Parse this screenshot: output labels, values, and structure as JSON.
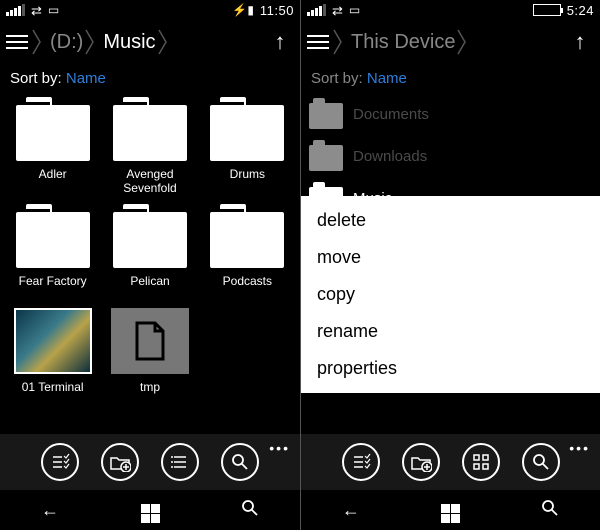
{
  "left": {
    "status": {
      "time": "11:50",
      "battery_charging": true
    },
    "breadcrumb": {
      "drive": "(D:)",
      "folder": "Music"
    },
    "sort": {
      "label": "Sort by: ",
      "value": "Name"
    },
    "items": [
      {
        "label": "Adler",
        "type": "folder"
      },
      {
        "label": "Avenged Sevenfold",
        "type": "folder"
      },
      {
        "label": "Drums",
        "type": "folder"
      },
      {
        "label": "Fear Factory",
        "type": "folder"
      },
      {
        "label": "Pelican",
        "type": "folder"
      },
      {
        "label": "Podcasts",
        "type": "folder"
      },
      {
        "label": "01 Terminal",
        "type": "image"
      },
      {
        "label": "tmp",
        "type": "file"
      }
    ]
  },
  "right": {
    "status": {
      "time": "5:24"
    },
    "breadcrumb": {
      "title": "This Device"
    },
    "sort": {
      "label": "Sort by: ",
      "value": "Name"
    },
    "items": [
      {
        "label": "Documents"
      },
      {
        "label": "Downloads"
      },
      {
        "label": "Music",
        "selected": true
      }
    ],
    "context_menu": [
      "delete",
      "move",
      "copy",
      "rename",
      "properties"
    ]
  },
  "appbar_icons": [
    "select",
    "new-folder",
    "view",
    "search"
  ],
  "nav": [
    "back",
    "start",
    "search"
  ]
}
